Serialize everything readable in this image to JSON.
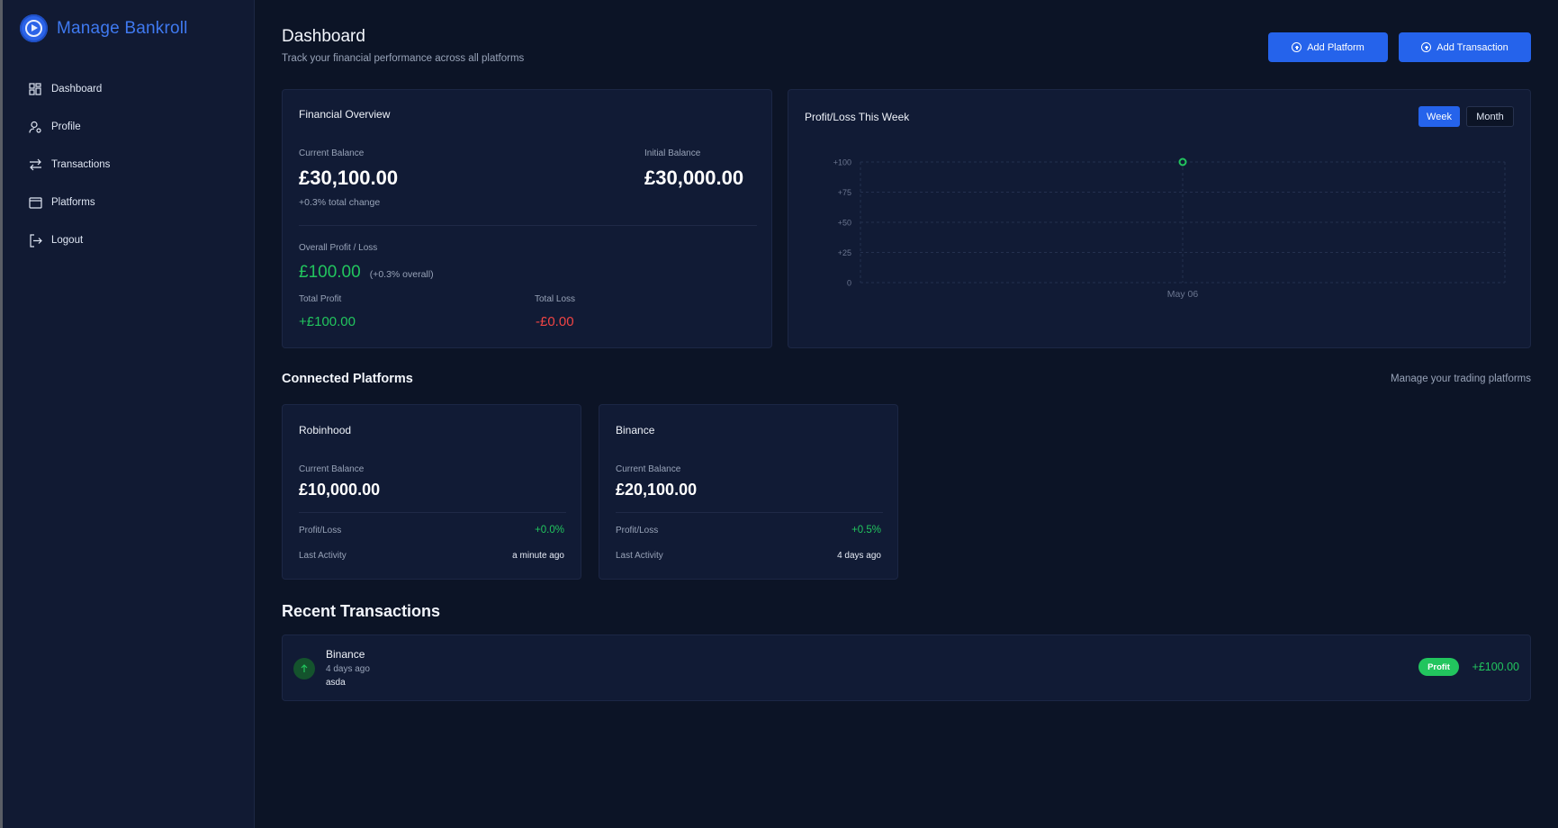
{
  "app": {
    "name": "Manage Bankroll"
  },
  "sidebar": {
    "items": [
      {
        "label": "Dashboard",
        "icon": "dashboard-grid-icon"
      },
      {
        "label": "Profile",
        "icon": "user-gear-icon"
      },
      {
        "label": "Transactions",
        "icon": "arrows-swap-icon"
      },
      {
        "label": "Platforms",
        "icon": "window-icon"
      },
      {
        "label": "Logout",
        "icon": "logout-icon"
      }
    ]
  },
  "header": {
    "title": "Dashboard",
    "subtitle": "Track your financial performance across all platforms",
    "add_platform_label": "Add Platform",
    "add_transaction_label": "Add Transaction"
  },
  "overview": {
    "title": "Financial Overview",
    "current_balance_label": "Current Balance",
    "current_balance": "£30,100.00",
    "total_change": "+0.3% total change",
    "initial_balance_label": "Initial Balance",
    "initial_balance": "£30,000.00",
    "overall_label": "Overall Profit / Loss",
    "overall_value": "£100.00",
    "overall_pct": "(+0.3% overall)",
    "total_profit_label": "Total Profit",
    "total_profit": "+£100.00",
    "total_loss_label": "Total Loss",
    "total_loss": "-£0.00"
  },
  "pl_chart": {
    "title": "Profit/Loss This Week",
    "week_label": "Week",
    "month_label": "Month",
    "selected": "Week"
  },
  "chart_data": {
    "type": "line",
    "x": [
      "May 06"
    ],
    "series": [
      {
        "values": [
          100
        ]
      }
    ],
    "yticks": [
      "+100",
      "+75",
      "+50",
      "+25",
      "0"
    ],
    "ylim": [
      0,
      100
    ],
    "grid": true,
    "point_color": "#22c55e"
  },
  "connected": {
    "title": "Connected Platforms",
    "manage_label": "Manage your trading platforms",
    "platforms": [
      {
        "name": "Robinhood",
        "balance_label": "Current Balance",
        "balance": "£10,000.00",
        "pl_label": "Profit/Loss",
        "pl": "+0.0%",
        "activity_label": "Last Activity",
        "activity": "a minute ago"
      },
      {
        "name": "Binance",
        "balance_label": "Current Balance",
        "balance": "£20,100.00",
        "pl_label": "Profit/Loss",
        "pl": "+0.5%",
        "activity_label": "Last Activity",
        "activity": "4 days ago"
      }
    ]
  },
  "recent": {
    "title": "Recent Transactions",
    "items": [
      {
        "platform": "Binance",
        "time": "4 days ago",
        "note": "asda",
        "badge": "Profit",
        "amount": "+£100.00",
        "icon": "arrow-up-icon"
      }
    ]
  },
  "colors": {
    "accent": "#2563eb",
    "profit": "#22c55e",
    "loss": "#ef4444",
    "background": "#0c1426",
    "card": "#111b35"
  }
}
